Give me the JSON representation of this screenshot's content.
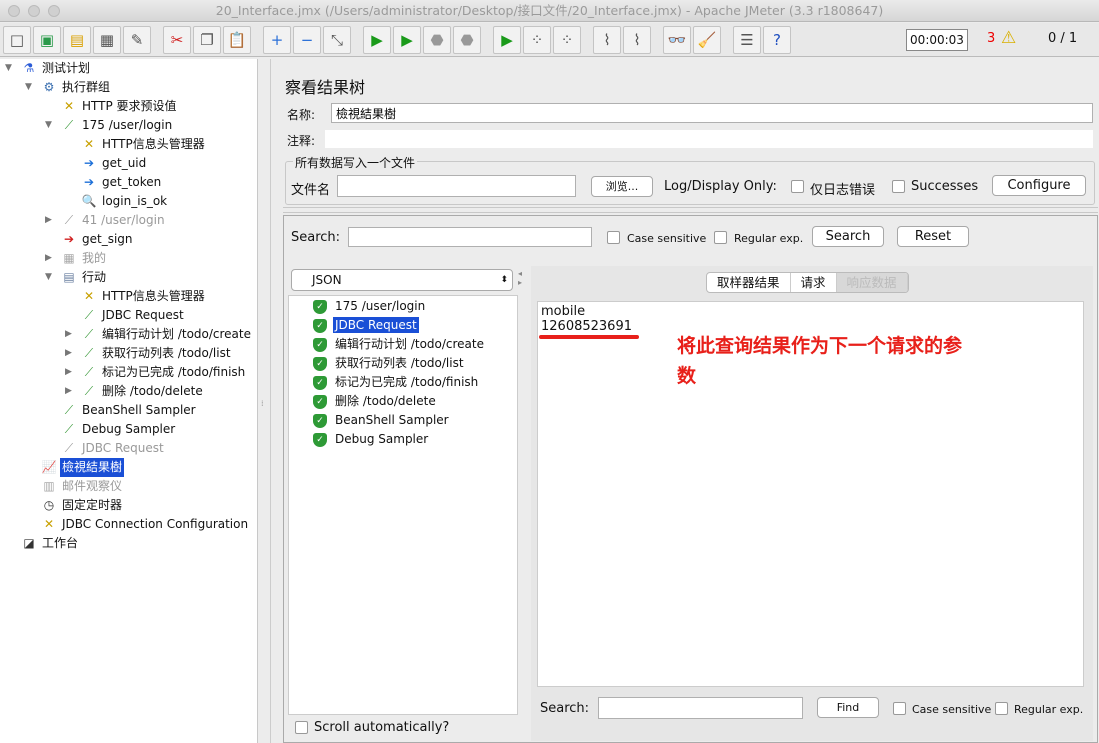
{
  "window": {
    "title": "20_Interface.jmx (/Users/administrator/Desktop/接口文件/20_Interface.jmx) - Apache JMeter (3.3 r1808647)"
  },
  "toolbar": {
    "timer": "00:00:03",
    "warning_count": "3",
    "threads": "0 / 1",
    "buttons": [
      {
        "name": "new",
        "glyph": "□"
      },
      {
        "name": "templates",
        "glyph": "▣"
      },
      {
        "name": "open",
        "glyph": "▤"
      },
      {
        "name": "save",
        "glyph": "▦"
      },
      {
        "name": "save-as",
        "glyph": "✎"
      },
      {
        "name": "cut",
        "glyph": "✂"
      },
      {
        "name": "copy",
        "glyph": "❐"
      },
      {
        "name": "paste",
        "glyph": "📋"
      },
      {
        "name": "expand",
        "glyph": "+"
      },
      {
        "name": "collapse",
        "glyph": "−"
      },
      {
        "name": "toggle",
        "glyph": "⤡"
      },
      {
        "name": "start",
        "glyph": "▶"
      },
      {
        "name": "start-no-pause",
        "glyph": "▶"
      },
      {
        "name": "stop",
        "glyph": "⬣"
      },
      {
        "name": "shutdown",
        "glyph": "⬣"
      },
      {
        "name": "remote-start",
        "glyph": "▶"
      },
      {
        "name": "remote-stop",
        "glyph": "⁘"
      },
      {
        "name": "remote-shutdown",
        "glyph": "⁘"
      },
      {
        "name": "clear",
        "glyph": "⌇"
      },
      {
        "name": "clear-all",
        "glyph": "⌇"
      },
      {
        "name": "search",
        "glyph": "👓"
      },
      {
        "name": "reset-search",
        "glyph": "🧹"
      },
      {
        "name": "function-helper",
        "glyph": "☰"
      },
      {
        "name": "help",
        "glyph": "?"
      }
    ]
  },
  "tree": [
    {
      "label": "测试计划",
      "level": 0,
      "exp": "down",
      "icon": "flask-icon",
      "glyph": "⚗",
      "color": "#2a5bd7"
    },
    {
      "label": "执行群组",
      "level": 1,
      "exp": "down",
      "icon": "gear-icon",
      "glyph": "⚙",
      "color": "#3a6fb0"
    },
    {
      "label": "HTTP 要求预设值",
      "level": 2,
      "icon": "tools-icon",
      "glyph": "✕",
      "color": "#c8a000"
    },
    {
      "label": "175 /user/login",
      "level": 2,
      "exp": "down",
      "icon": "pipette-icon",
      "glyph": "⟋",
      "color": "#3a9a3a"
    },
    {
      "label": "HTTP信息头管理器",
      "level": 3,
      "icon": "tools-icon",
      "glyph": "✕",
      "color": "#c8a000"
    },
    {
      "label": "get_uid",
      "level": 3,
      "icon": "extractor-icon",
      "glyph": "➔",
      "color": "#1c6fd8"
    },
    {
      "label": "get_token",
      "level": 3,
      "icon": "extractor-icon",
      "glyph": "➔",
      "color": "#1c6fd8"
    },
    {
      "label": "login_is_ok",
      "level": 3,
      "icon": "assertion-icon",
      "glyph": "🔍",
      "color": "#4a7fb0"
    },
    {
      "label": "41 /user/login",
      "level": 2,
      "exp": "right",
      "icon": "pipette-icon",
      "glyph": "⟋",
      "color": "#999",
      "disabled": true
    },
    {
      "label": "get_sign",
      "level": 2,
      "icon": "preprocessor-icon",
      "glyph": "➔",
      "color": "#d02020"
    },
    {
      "label": "我的",
      "level": 2,
      "exp": "right",
      "icon": "controller-icon",
      "glyph": "▦",
      "color": "#aaa",
      "disabled": true
    },
    {
      "label": "行动",
      "level": 2,
      "exp": "down",
      "icon": "controller-icon",
      "glyph": "▤",
      "color": "#6a7fa0"
    },
    {
      "label": "HTTP信息头管理器",
      "level": 3,
      "icon": "tools-icon",
      "glyph": "✕",
      "color": "#c8a000"
    },
    {
      "label": "JDBC Request",
      "level": 3,
      "icon": "pipette-icon",
      "glyph": "⟋",
      "color": "#3a9a3a"
    },
    {
      "label": "编辑行动计划 /todo/create",
      "level": 3,
      "exp": "right",
      "icon": "pipette-icon",
      "glyph": "⟋",
      "color": "#3a9a3a"
    },
    {
      "label": "获取行动列表 /todo/list",
      "level": 3,
      "exp": "right",
      "icon": "pipette-icon",
      "glyph": "⟋",
      "color": "#3a9a3a"
    },
    {
      "label": "标记为已完成 /todo/finish",
      "level": 3,
      "exp": "right",
      "icon": "pipette-icon",
      "glyph": "⟋",
      "color": "#3a9a3a"
    },
    {
      "label": "删除 /todo/delete",
      "level": 3,
      "exp": "right",
      "icon": "pipette-icon",
      "glyph": "⟋",
      "color": "#3a9a3a"
    },
    {
      "label": "BeanShell Sampler",
      "level": 2,
      "icon": "pipette-icon",
      "glyph": "⟋",
      "color": "#3a9a3a"
    },
    {
      "label": "Debug Sampler",
      "level": 2,
      "icon": "pipette-icon",
      "glyph": "⟋",
      "color": "#3a9a3a"
    },
    {
      "label": "JDBC Request",
      "level": 2,
      "icon": "pipette-icon",
      "glyph": "⟋",
      "color": "#999",
      "disabled": true
    },
    {
      "label": "檢視結果樹",
      "level": 1,
      "icon": "chart-icon",
      "glyph": "📈",
      "color": "#b040b0",
      "selected": true
    },
    {
      "label": "邮件观察仪",
      "level": 1,
      "icon": "chart-icon",
      "glyph": "▥",
      "color": "#aaa",
      "disabled": true
    },
    {
      "label": "固定定时器",
      "level": 1,
      "icon": "timer-icon",
      "glyph": "◷",
      "color": "#333"
    },
    {
      "label": "JDBC Connection Configuration",
      "level": 1,
      "icon": "tools-icon",
      "glyph": "✕",
      "color": "#c8a000"
    },
    {
      "label": "工作台",
      "level": 0,
      "icon": "workbench-icon",
      "glyph": "◪",
      "color": "#333"
    }
  ],
  "panel": {
    "title": "察看结果树",
    "name_label": "名称:",
    "name_value": "檢視結果樹",
    "comment_label": "注释:",
    "file_group": "所有数据写入一个文件",
    "file_label": "文件名",
    "browse": "浏览...",
    "log_display": "Log/Display Only:",
    "errors_only": "仅日志错误",
    "successes": "Successes",
    "configure": "Configure"
  },
  "search": {
    "label": "Search:",
    "case_sensitive": "Case sensitive",
    "regex": "Regular exp.",
    "search_btn": "Search",
    "reset_btn": "Reset"
  },
  "results": {
    "renderer": "JSON",
    "items": [
      "175 /user/login",
      "JDBC Request",
      "编辑行动计划 /todo/create",
      "获取行动列表 /todo/list",
      "标记为已完成 /todo/finish",
      "删除 /todo/delete",
      "BeanShell Sampler",
      "Debug Sampler"
    ],
    "selected_index": 1,
    "scroll_auto": "Scroll automatically?"
  },
  "detail": {
    "tabs": [
      "取样器结果",
      "请求",
      "响应数据"
    ],
    "active_tab": 2,
    "lines": [
      "mobile",
      "12608523691"
    ],
    "annotation": "将此查询结果作为下一个请求的参数",
    "annotation_color": "#e8201a",
    "search_label": "Search:",
    "find": "Find",
    "case_sensitive": "Case sensitive",
    "regex": "Regular exp."
  }
}
